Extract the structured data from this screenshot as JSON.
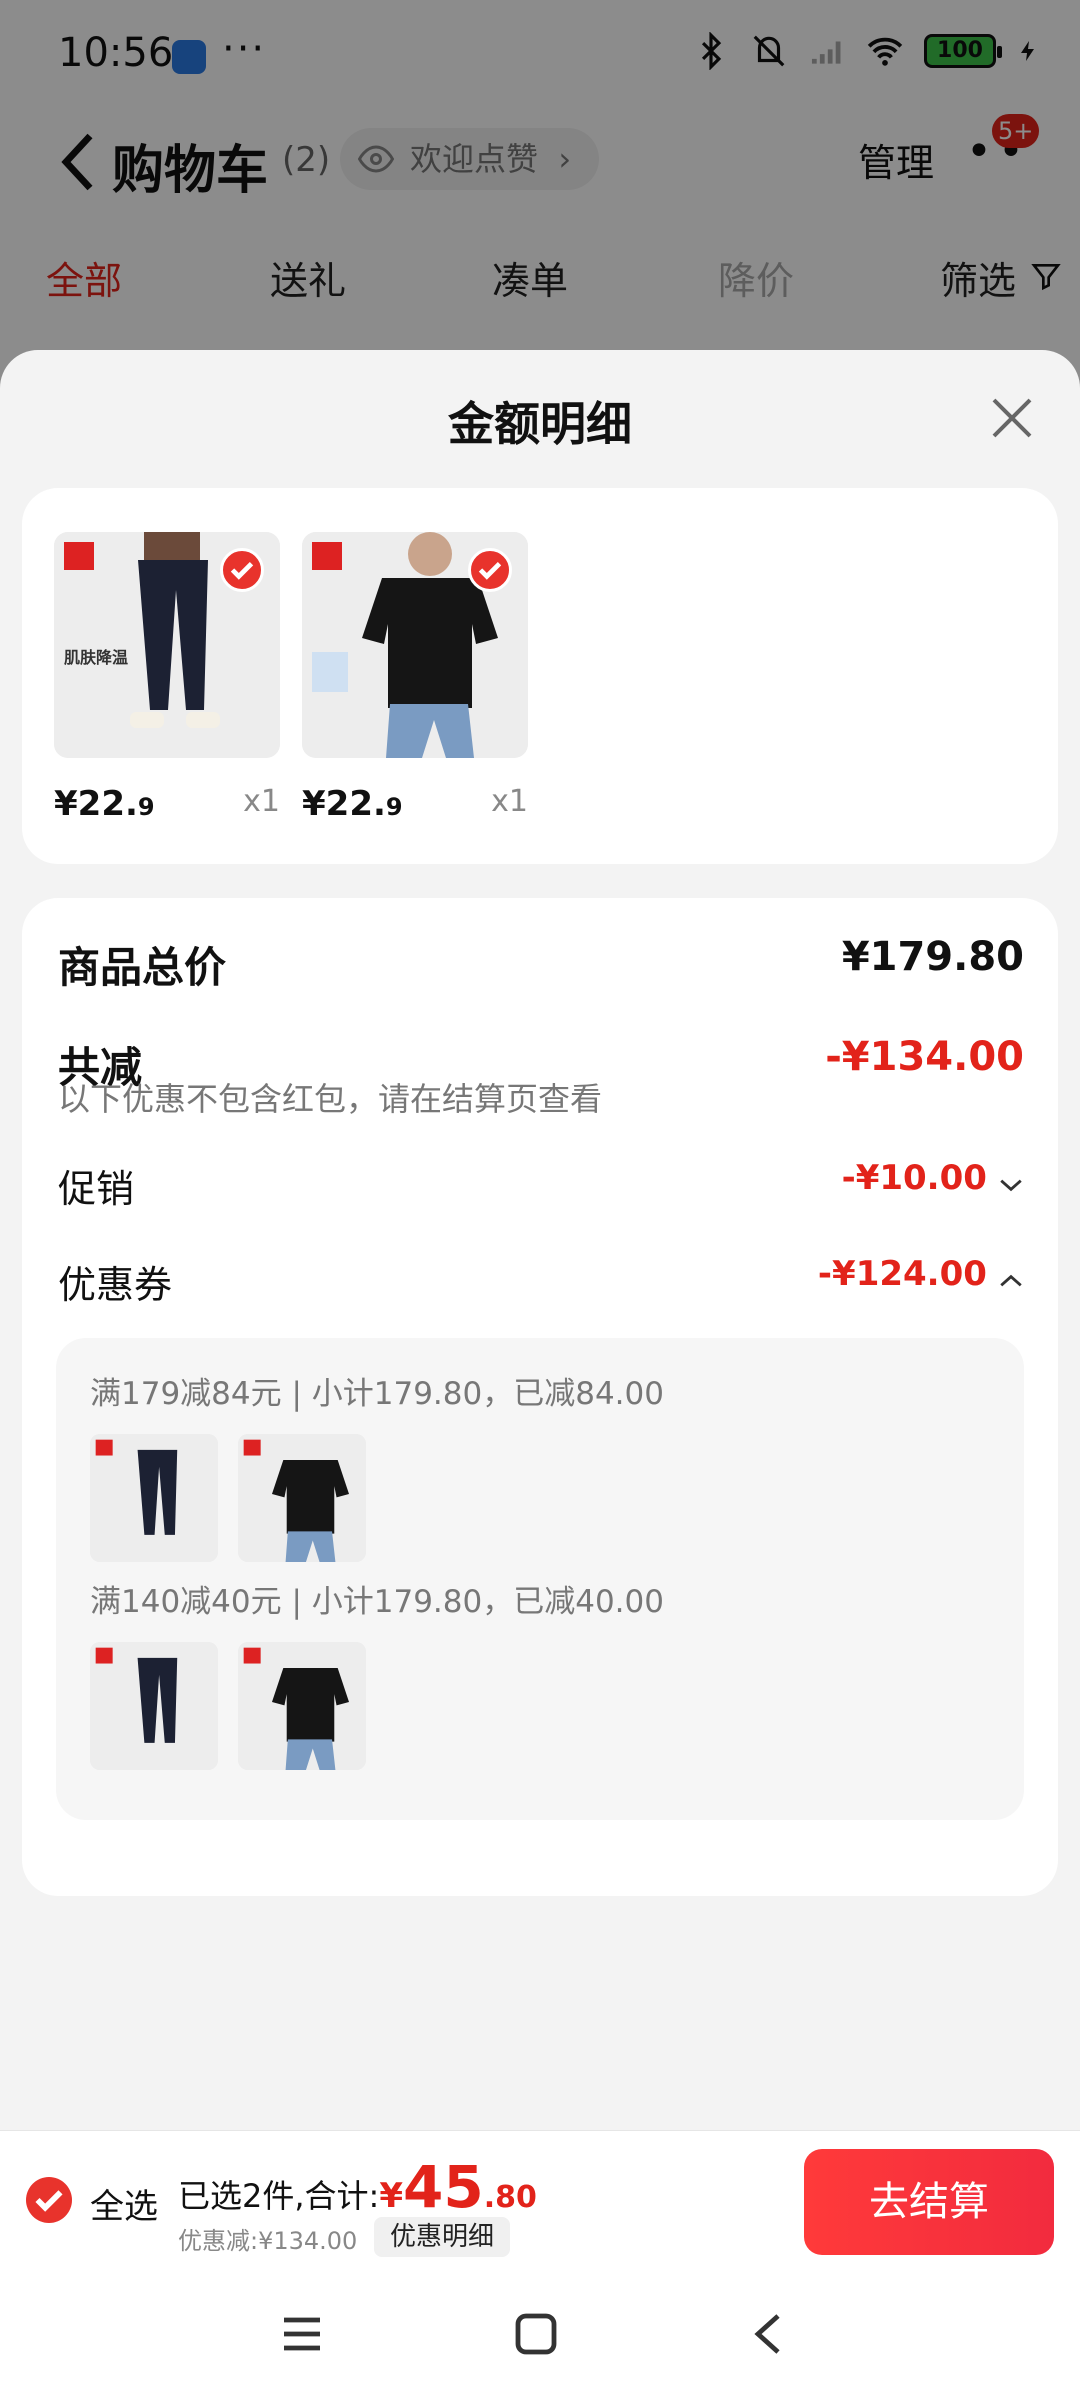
{
  "status_bar": {
    "time": "10:56",
    "dots": "···",
    "battery": "100"
  },
  "header": {
    "title": "购物车",
    "count": "(2)",
    "like_label": "欢迎点赞",
    "manage_label": "管理",
    "more_dots": "••",
    "badge": "5+"
  },
  "tabs": [
    {
      "label": "全部",
      "state": "active"
    },
    {
      "label": "送礼",
      "state": "normal"
    },
    {
      "label": "凑单",
      "state": "normal"
    },
    {
      "label": "降价",
      "state": "muted"
    },
    {
      "label": "筛选",
      "state": "normal"
    }
  ],
  "sheet": {
    "title": "金额明细",
    "items": [
      {
        "price_int": "¥22.",
        "price_dec": "9",
        "qty": "x1",
        "tag": "肌肤降温",
        "kind": "pants"
      },
      {
        "price_int": "¥22.",
        "price_dec": "9",
        "qty": "x1",
        "tag": "",
        "kind": "polo"
      }
    ],
    "summary": {
      "goods_total_label": "商品总价",
      "goods_total_value": "¥179.80",
      "total_discount_label": "共减",
      "total_discount_value": "-¥134.00",
      "note": "以下优惠不包含红包，请在结算页查看",
      "promo_label": "促销",
      "promo_value": "-¥10.00",
      "coupon_label": "优惠券",
      "coupon_value": "-¥124.00"
    },
    "coupons": [
      {
        "text": "满179减84元 | 小计179.80，已减84.00"
      },
      {
        "text": "满140减40元 | 小计179.80，已减40.00"
      }
    ]
  },
  "checkout": {
    "select_all": "全选",
    "selected_text": "已选2件,合计:",
    "yen": "¥",
    "total_int": "45",
    "total_dec": ".80",
    "discount_text": "优惠减:¥134.00",
    "detail_chip": "优惠明细",
    "pay_label": "去结算"
  },
  "colors": {
    "accent": "#e2231a",
    "button": "#f22b3e"
  },
  "icons": {
    "close": "close-icon",
    "check": "check-icon",
    "back": "back-chevron-icon"
  }
}
